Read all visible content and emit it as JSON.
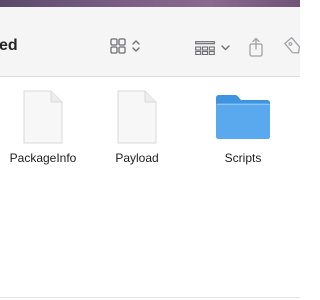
{
  "window": {
    "title": "ed"
  },
  "toolbar": {
    "view_icon": "grid-view-icon",
    "group_icon": "group-by-icon",
    "share_icon": "share-icon",
    "tag_icon": "tag-icon"
  },
  "files": [
    {
      "name": "PackageInfo",
      "kind": "document",
      "icon": "document-icon"
    },
    {
      "name": "Payload",
      "kind": "document",
      "icon": "document-icon"
    },
    {
      "name": "Scripts",
      "kind": "folder",
      "icon": "folder-icon"
    }
  ],
  "colors": {
    "folder": "#5aa9ee",
    "document": "#f7f7f7"
  }
}
